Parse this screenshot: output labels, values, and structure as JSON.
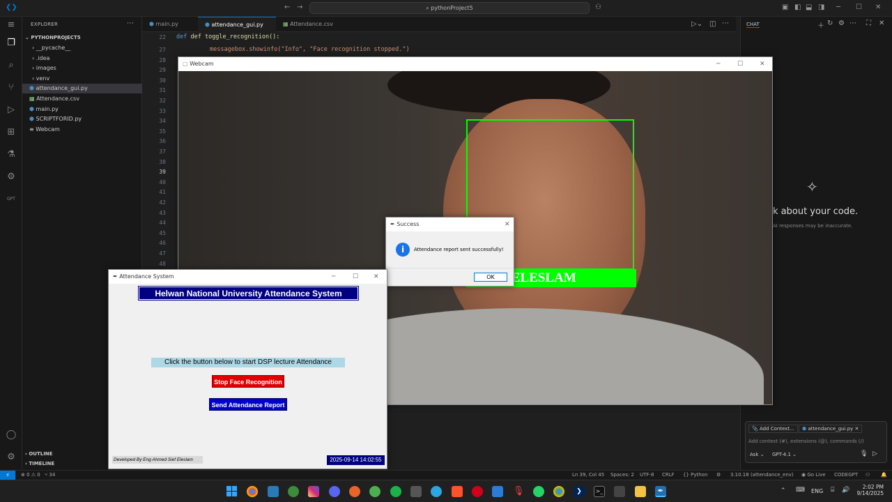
{
  "titlebar": {
    "search": "pythonProject5"
  },
  "explorer": {
    "header": "EXPLORER",
    "project": "PYTHONPROJECT5",
    "items": [
      {
        "label": "__pycache__",
        "kind": "folder"
      },
      {
        "label": ".idea",
        "kind": "folder"
      },
      {
        "label": "images",
        "kind": "folder"
      },
      {
        "label": "venv",
        "kind": "folder"
      },
      {
        "label": "attendance_gui.py",
        "kind": "py"
      },
      {
        "label": "Attendance.csv",
        "kind": "csv"
      },
      {
        "label": "main.py",
        "kind": "py"
      },
      {
        "label": "SCRIPTFORID.py",
        "kind": "py"
      },
      {
        "label": "Webcam",
        "kind": "file"
      }
    ],
    "outline": "OUTLINE",
    "timeline": "TIMELINE"
  },
  "tabs": [
    {
      "label": "main.py"
    },
    {
      "label": "attendance_gui.py"
    },
    {
      "label": "Attendance.csv"
    }
  ],
  "editor": {
    "sticky_line": "22",
    "sticky_code": "def toggle_recognition():",
    "line_numbers": [
      "27",
      "28",
      "29",
      "30",
      "31",
      "32",
      "33",
      "34",
      "35",
      "36",
      "37",
      "38",
      "39",
      "40",
      "41",
      "42",
      "43",
      "44",
      "45",
      "46",
      "47",
      "48"
    ],
    "code_line": "messagebox.showinfo(\"Info\", \"Face recognition stopped.\")"
  },
  "chat": {
    "header": "CHAT",
    "heading": "k about your code.",
    "subtext": "AI responses may be inaccurate.",
    "add_context": "Add Context...",
    "file_chip": "attendance_gui.py",
    "placeholder": "Add context (#), extensions (@), commands (/)",
    "mode": "Ask",
    "model": "GPT-4.1"
  },
  "webcam": {
    "title": "Webcam",
    "label": "D SIEF ELESLAM"
  },
  "success": {
    "title": "Success",
    "message": "Attendance report sent successfully!",
    "ok": "OK"
  },
  "attendance": {
    "title": "Attendance System",
    "banner": "Helwan National University Attendance System",
    "instruction": "Click the button below to start DSP lecture Attendance",
    "stop_button": "Stop Face Recognition",
    "send_button": "Send Attendance Report",
    "footer": "Developed By Eng Ahmed Sief Eleslam",
    "datetime": "2025-09-14 14:02:55"
  },
  "status": {
    "errors": "⊗ 0 ⚠ 0",
    "ports": "⑂ 34",
    "position": "Ln 39, Col 45",
    "spaces": "Spaces: 2",
    "encoding": "UTF-8",
    "eol": "CRLF",
    "language": "{} Python",
    "interpreter": "3.10.18 (attendance_env)",
    "golive": "Go Live",
    "codegpt": "CODEGPT"
  },
  "tray": {
    "lang": "ENG",
    "time": "2:02 PM",
    "date": "9/14/2025"
  },
  "colors": {
    "accent": "#0078d4",
    "face_box": "#00ff00",
    "banner_bg": "#000080",
    "stop_bg": "#e00000",
    "send_bg": "#0000c8"
  }
}
